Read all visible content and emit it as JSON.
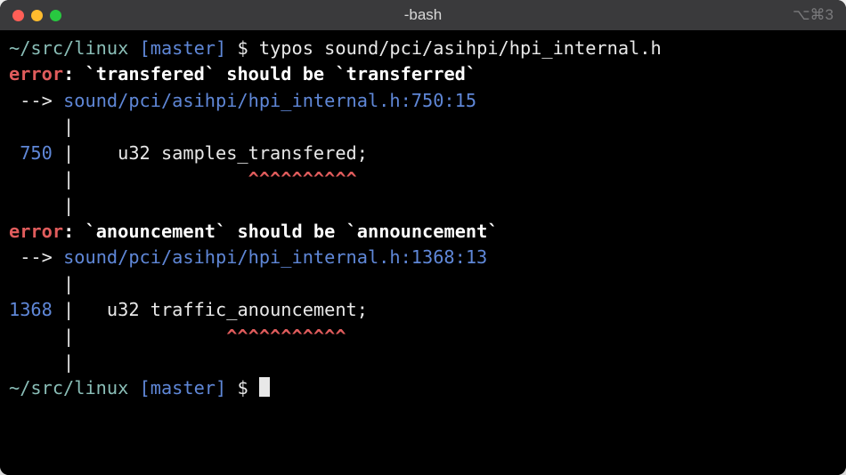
{
  "window": {
    "title": "-bash",
    "shortcut": "⌥⌘3"
  },
  "prompt": {
    "path": "~/src/linux",
    "branch": "[master]",
    "symbol": "$"
  },
  "command": "typos sound/pci/asihpi/hpi_internal.h",
  "errors": [
    {
      "label": "error",
      "colon": ": ",
      "tick": "`",
      "misspelling": "transfered",
      "should_be": " should be ",
      "correction": "transferred",
      "arrow": " --> ",
      "location": "sound/pci/asihpi/hpi_internal.h:750:15",
      "gutter_empty": "     | ",
      "lineno": " 750",
      "gutter_bar": " | ",
      "code_pre": "   u32 samples_",
      "code_bad": "transfered",
      "code_post": ";",
      "caret_pad": "     |                ",
      "carets": "^^^^^^^^^^"
    },
    {
      "label": "error",
      "colon": ": ",
      "tick": "`",
      "misspelling": "anouncement",
      "should_be": " should be ",
      "correction": "announcement",
      "arrow": " --> ",
      "location": "sound/pci/asihpi/hpi_internal.h:1368:13",
      "gutter_empty": "     | ",
      "lineno": "1368",
      "gutter_bar": " | ",
      "code_pre": "  u32 traffic_",
      "code_bad": "anouncement",
      "code_post": ";",
      "caret_pad": "     |              ",
      "carets": "^^^^^^^^^^^"
    }
  ]
}
